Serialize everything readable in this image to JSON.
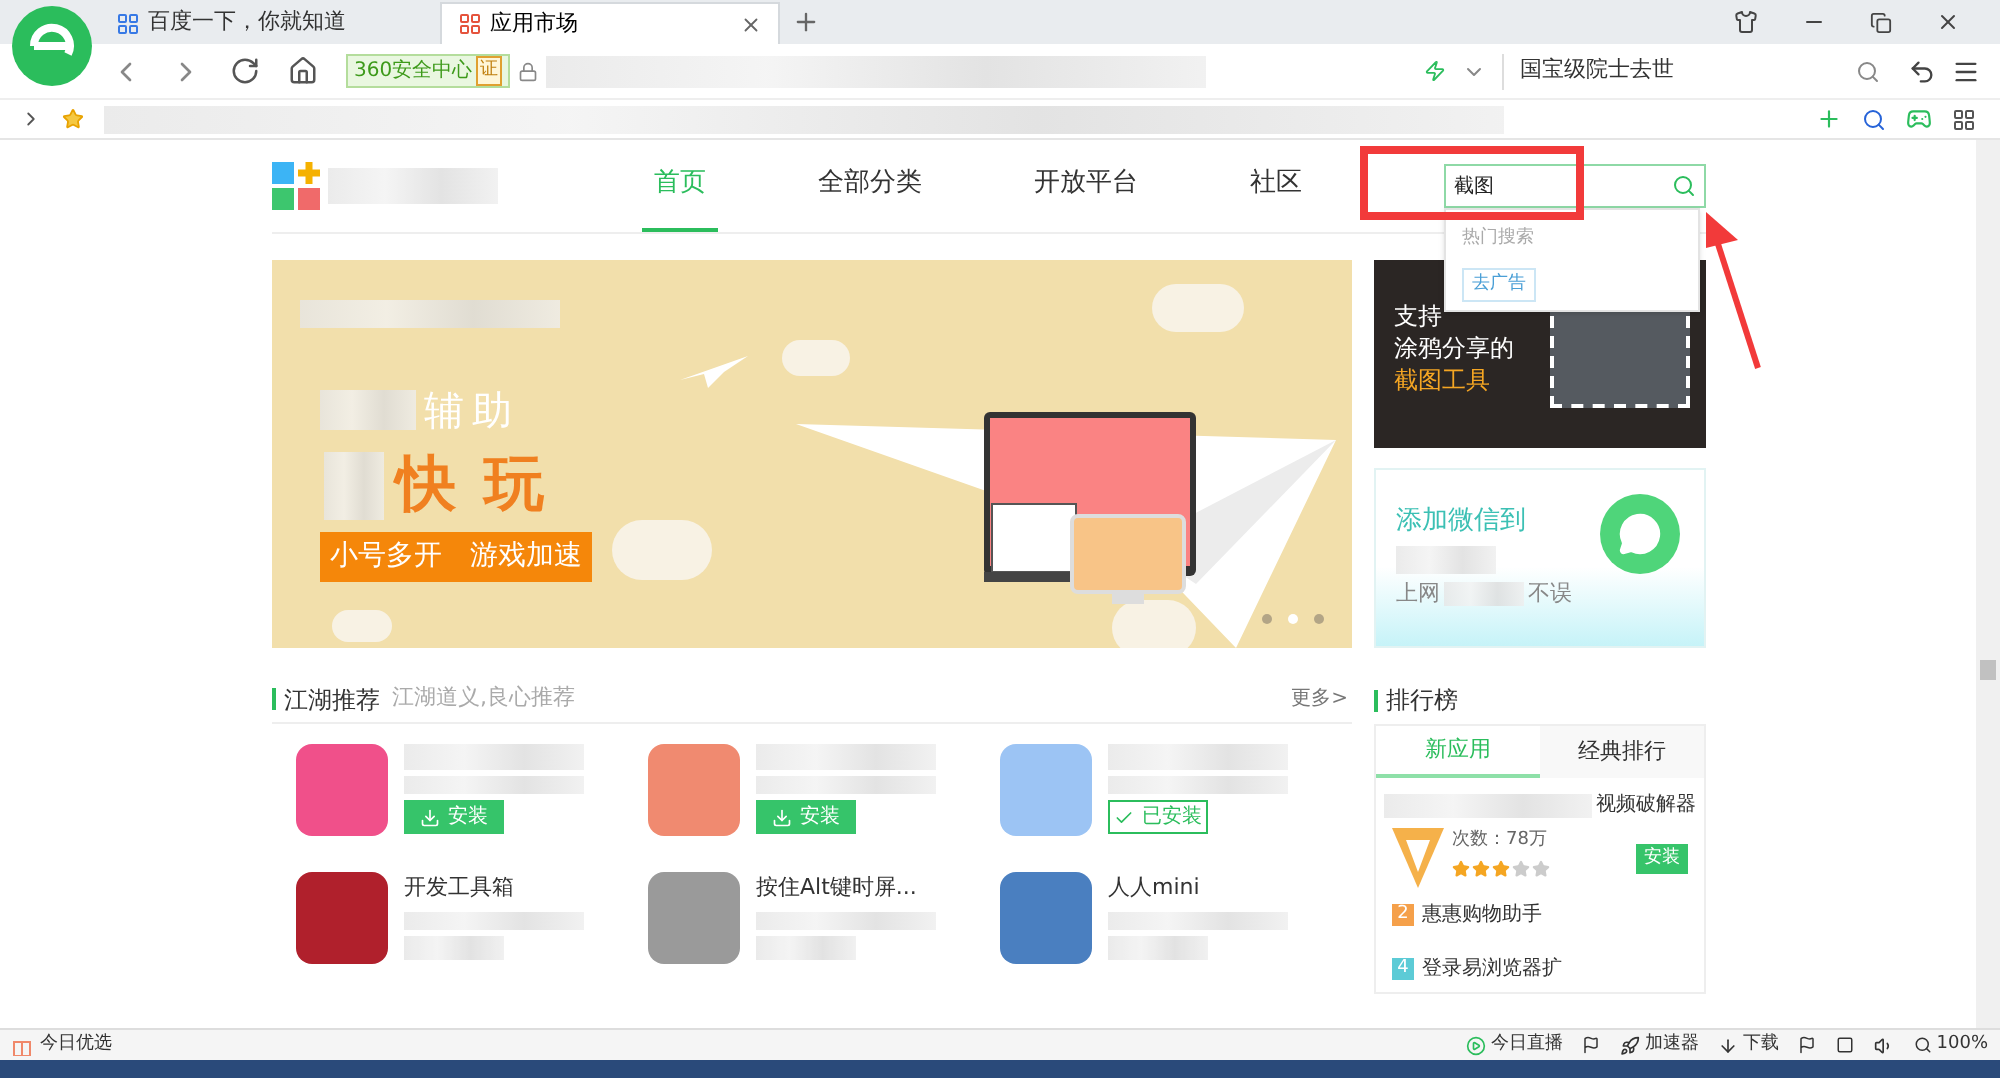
{
  "browser": {
    "tabs": [
      {
        "title": "百度一下，你就知道",
        "selected": false
      },
      {
        "title": "应用市场",
        "selected": true
      }
    ],
    "address": {
      "badge": "360安全中心",
      "cert": "证"
    },
    "hot_search": "国宝级院士去世"
  },
  "site": {
    "nav": [
      {
        "label": "首页",
        "selected": true
      },
      {
        "label": "全部分类",
        "selected": false
      },
      {
        "label": "开放平台",
        "selected": false
      },
      {
        "label": "社区",
        "selected": false
      }
    ],
    "search": {
      "value": "截图",
      "dropdown_title": "热门搜索",
      "suggestions": [
        "去广告"
      ]
    }
  },
  "banner": {
    "subtitle": "辅助",
    "headline": "快玩",
    "tags": [
      "小号多开",
      "游戏加速"
    ],
    "dots": [
      {
        "selected": false
      },
      {
        "selected": true
      },
      {
        "selected": false
      }
    ]
  },
  "ads": [
    {
      "lines": [
        "支持",
        "涂鸦分享的"
      ],
      "highlight": "截图工具"
    },
    {
      "lines": [
        "添加微信到"
      ],
      "tail": [
        "上网",
        "不误"
      ]
    }
  ],
  "recommend": {
    "title": "江湖推荐",
    "subtitle": "江湖道义,良心推荐",
    "more": "更多>",
    "apps": [
      {
        "button": "安装",
        "installed": false,
        "color": "#f0508a"
      },
      {
        "button": "安装",
        "installed": false,
        "color": "#f08a70"
      },
      {
        "button": "已安装",
        "installed": true,
        "color": "#9cc4f4"
      },
      {
        "name": "开发工具箱",
        "color": "#b0202c"
      },
      {
        "name": "按住Alt键时屏...",
        "color": "#9a9a9a"
      },
      {
        "name": "人人mini",
        "color": "#4a7fc0"
      }
    ]
  },
  "ranking": {
    "title": "排行榜",
    "tabs": [
      {
        "label": "新应用",
        "selected": true
      },
      {
        "label": "经典排行",
        "selected": false
      }
    ],
    "top": {
      "name": "视频破解器",
      "downloads": "次数：78万",
      "stars": 3,
      "button": "安装"
    },
    "list": [
      {
        "rank": "2",
        "name": "惠惠购物助手",
        "color": "#f5a04a"
      },
      {
        "rank": "4",
        "name": "登录易浏览器扩",
        "color": "#5ccbd6"
      }
    ]
  },
  "status": {
    "left": "今日优选",
    "items": [
      "今日直播",
      "加速器",
      "下载"
    ],
    "zoom": "100%"
  }
}
